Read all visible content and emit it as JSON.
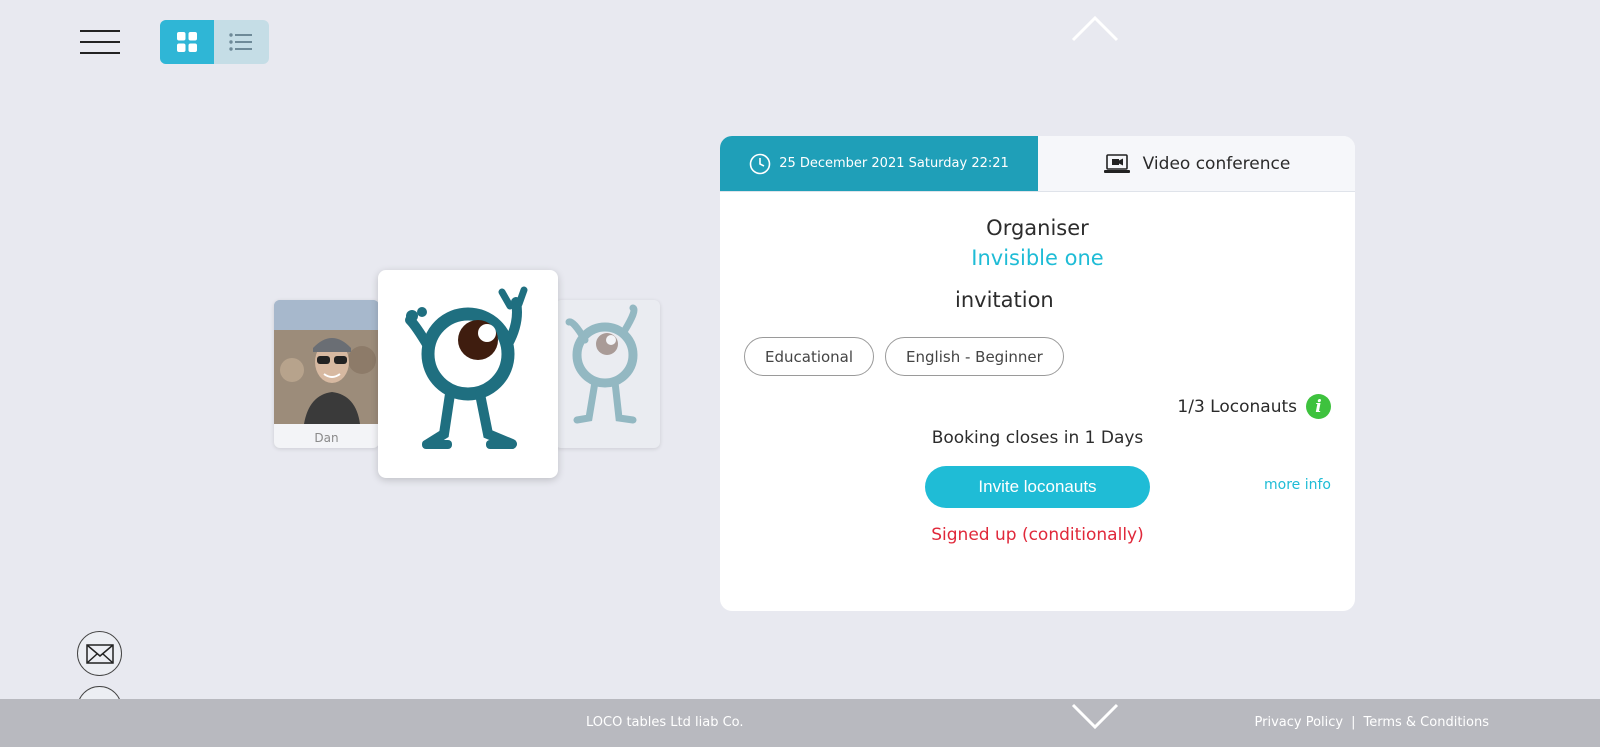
{
  "header": {
    "menu_icon": "hamburger-icon",
    "view_toggle": [
      {
        "name": "grid-view",
        "icon": "grid-icon",
        "active": true
      },
      {
        "name": "list-view",
        "icon": "list-icon",
        "active": false
      }
    ],
    "nav_up_icon": "chevron-up-icon"
  },
  "cards": {
    "left_name": "Dan"
  },
  "event": {
    "date_text": "25 December 2021 Saturday 22:21",
    "type_text": "Video conference",
    "organiser_label": "Organiser",
    "organiser_name": "Invisible one",
    "invitation_label": "invitation",
    "tags": [
      "Educational",
      "English - Beginner"
    ],
    "loconauts_text": "1/3 Loconauts",
    "info_icon_glyph": "i",
    "booking_text": "Booking closes in 1 Days",
    "invite_button_label": "Invite loconauts",
    "more_info_label": "more info",
    "status_text": "Signed up (conditionally)"
  },
  "side_buttons": [
    {
      "name": "mail-button",
      "icon": "envelope-icon"
    },
    {
      "name": "filter-button",
      "icon": "filter-icon"
    }
  ],
  "footer": {
    "company": "LOCO tables Ltd liab Co.",
    "privacy": "Privacy Policy",
    "separator": "|",
    "terms": "Terms & Conditions"
  },
  "colors": {
    "accent": "#1fbcd6",
    "date_tab": "#1f9fb8",
    "status_red": "#e0283a",
    "info_green": "#3ec23e",
    "background": "#e8e9f0",
    "footer": "#b8b9bf"
  }
}
